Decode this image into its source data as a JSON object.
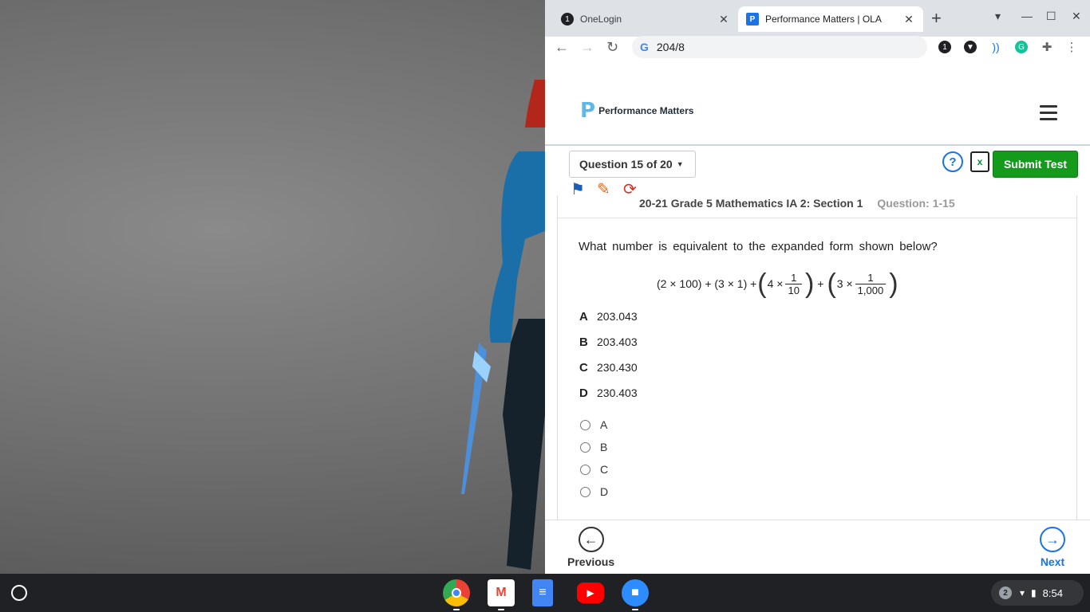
{
  "browser": {
    "tabs": [
      {
        "title": "OneLogin",
        "favicon": "1"
      },
      {
        "title": "Performance Matters | OLA",
        "favicon": "P"
      }
    ],
    "address": "204/8",
    "new_tab_symbol": "+"
  },
  "app": {
    "logo_text": "Performance Matters",
    "question_selector": "Question 15 of 20",
    "help_symbol": "?",
    "calculator_symbol": "x",
    "submit_label": "Submit Test",
    "test_title": "20-21 Grade 5 Mathematics IA 2: Section 1",
    "test_subtitle": "Question: 1-15"
  },
  "question": {
    "prompt": "What number is equivalent to the expanded form shown below?",
    "formula": {
      "term1": "(2 × 100) + (3 × 1) +",
      "term3_lead": "4 ×",
      "frac1_num": "1",
      "frac1_den": "10",
      "plus": "+",
      "term4_lead": "3 ×",
      "frac2_num": "1",
      "frac2_den": "1,000"
    },
    "choices": [
      {
        "letter": "A",
        "value": "203.043"
      },
      {
        "letter": "B",
        "value": "203.403"
      },
      {
        "letter": "C",
        "value": "230.430"
      },
      {
        "letter": "D",
        "value": "230.403"
      }
    ],
    "answer_options": [
      "A",
      "B",
      "C",
      "D"
    ]
  },
  "footer": {
    "previous_label": "Previous",
    "next_label": "Next"
  },
  "shelf": {
    "notification_count": "2",
    "time": "8:54"
  },
  "colors": {
    "submit_green": "#149b1b",
    "next_blue": "#1a73e8",
    "shelf": "#202124"
  }
}
